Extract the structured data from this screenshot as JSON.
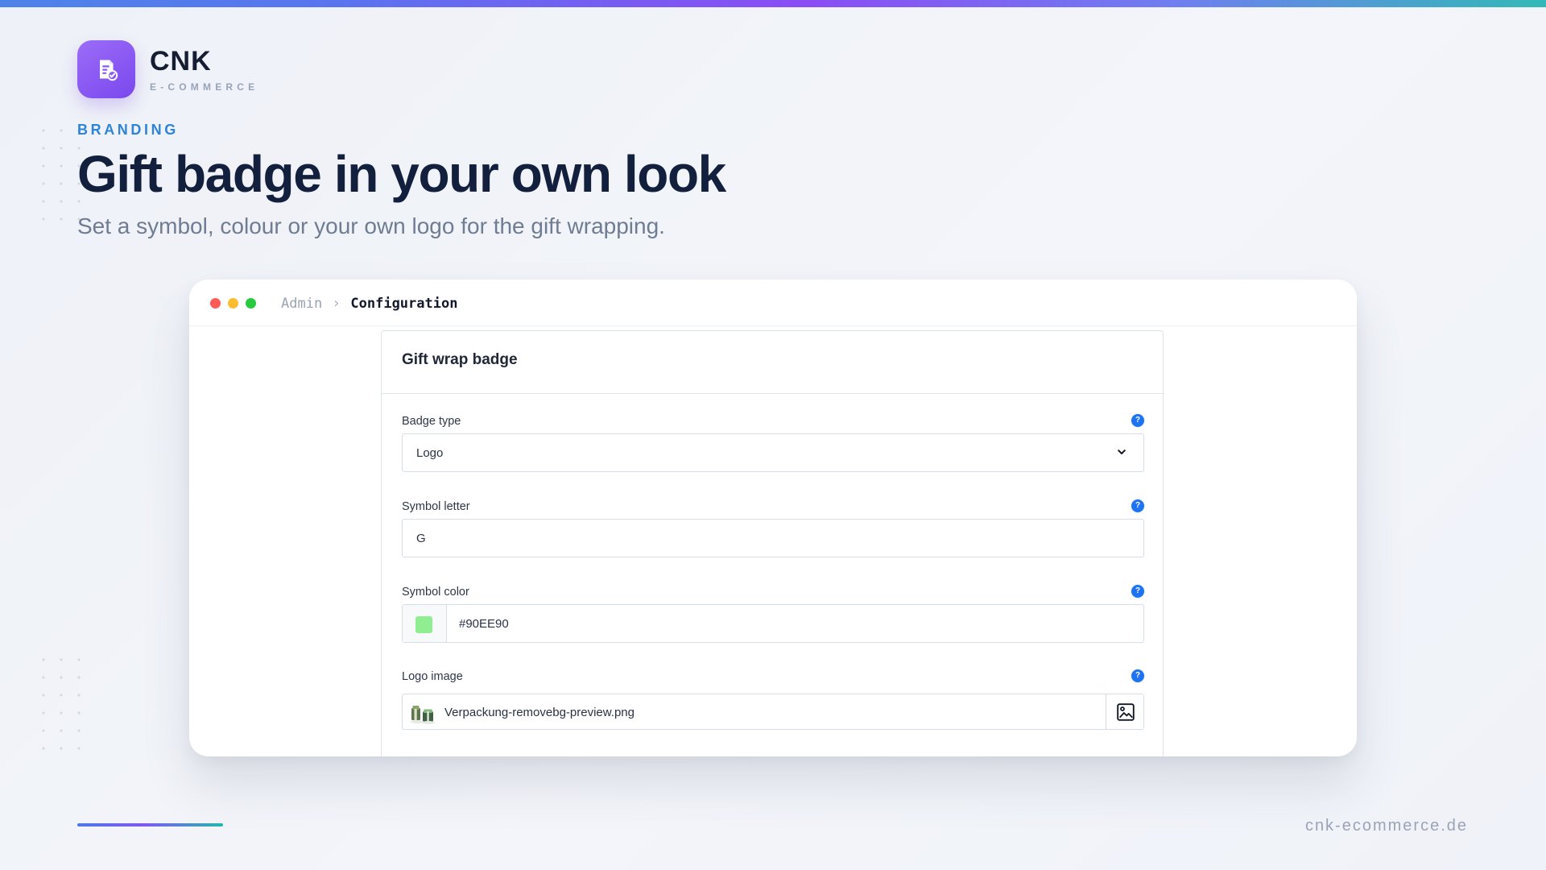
{
  "brand": {
    "name": "CNK",
    "subtitle": "E-COMMERCE",
    "icon": "document-check-icon",
    "accent": "#7B47ED"
  },
  "hero": {
    "kicker": "BRANDING",
    "title": "Gift badge in your own look",
    "subtitle": "Set a symbol, colour or your own logo for the gift wrapping."
  },
  "window": {
    "breadcrumb": [
      "Admin",
      "Configuration"
    ],
    "traffic_lights": [
      "#FF5B57",
      "#FEBD2F",
      "#27C93F"
    ]
  },
  "panel": {
    "title": "Gift wrap badge",
    "fields": {
      "badge_type": {
        "label": "Badge type",
        "value": "Logo",
        "icon": "chevron-down-icon",
        "help_icon": "help-icon",
        "help_text": "?"
      },
      "symbol_letter": {
        "label": "Symbol letter",
        "value": "G",
        "help_icon": "help-icon",
        "help_text": "?"
      },
      "symbol_color": {
        "label": "Symbol color",
        "value": "#90EE90",
        "swatch_color": "#90EE90",
        "help_icon": "help-icon",
        "help_text": "?"
      },
      "logo_image": {
        "label": "Logo image",
        "value": "Verpackung-removebg-preview.png",
        "thumbnail_icon": "gift-package-thumbnail",
        "button_icon": "image-icon",
        "help_icon": "help-icon",
        "help_text": "?"
      }
    }
  },
  "footer": {
    "url": "cnk-ecommerce.de"
  }
}
